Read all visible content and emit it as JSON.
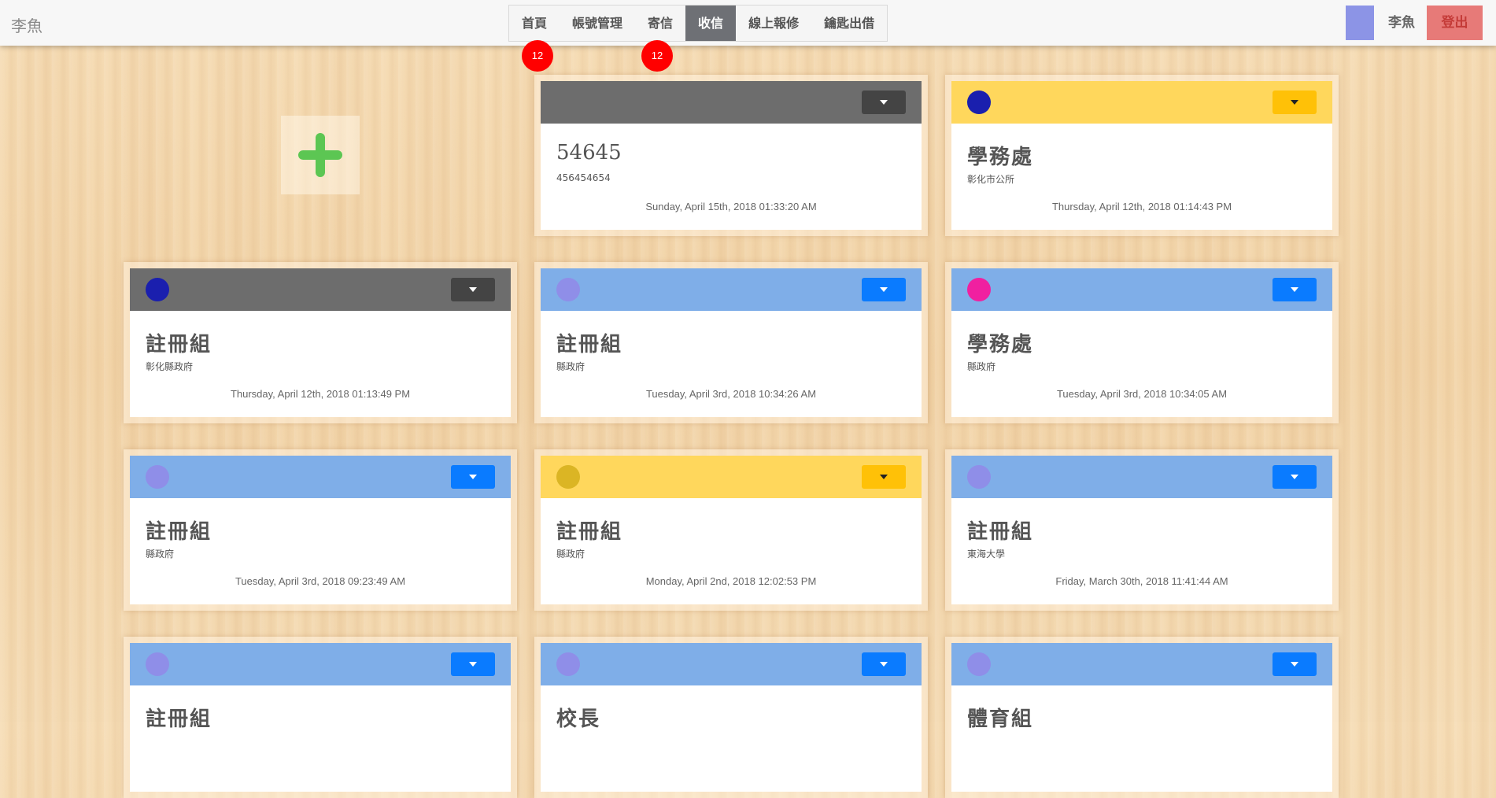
{
  "navbar": {
    "brand": "李魚",
    "items": [
      {
        "label": "首頁",
        "badge": "12",
        "active": false
      },
      {
        "label": "帳號管理",
        "badge": "",
        "active": false
      },
      {
        "label": "寄信",
        "badge": "12",
        "active": false
      },
      {
        "label": "收信",
        "badge": "",
        "active": true
      },
      {
        "label": "線上報修",
        "badge": "",
        "active": false
      },
      {
        "label": "鑰匙出借",
        "badge": "",
        "active": false
      }
    ],
    "user_name": "李魚",
    "logout_label": "登出",
    "user_color": "#8c94e6"
  },
  "add_button": {
    "icon": "plus-icon",
    "color": "#5cc653"
  },
  "cards": [
    {
      "theme": "gray",
      "dot_color": "",
      "title": "54645",
      "subtitle": "456454654",
      "date": "Sunday, April 15th, 2018 01:33:20 AM"
    },
    {
      "theme": "yellow",
      "dot_color": "#1a1fae",
      "title": "學務處",
      "subtitle": "彰化市公所",
      "date": "Thursday, April 12th, 2018 01:14:43 PM"
    },
    {
      "theme": "gray",
      "dot_color": "#1a1fae",
      "title": "註冊組",
      "subtitle": "彰化縣政府",
      "date": "Thursday, April 12th, 2018 01:13:49 PM"
    },
    {
      "theme": "blue",
      "dot_color": "#8f8ee8",
      "title": "註冊組",
      "subtitle": "縣政府",
      "date": "Tuesday, April 3rd, 2018 10:34:26 AM"
    },
    {
      "theme": "blue",
      "dot_color": "#f020a0",
      "title": "學務處",
      "subtitle": "縣政府",
      "date": "Tuesday, April 3rd, 2018 10:34:05 AM"
    },
    {
      "theme": "blue",
      "dot_color": "#8f8ee8",
      "title": "註冊組",
      "subtitle": "縣政府",
      "date": "Tuesday, April 3rd, 2018 09:23:49 AM"
    },
    {
      "theme": "yellow",
      "dot_color": "#dbb524",
      "title": "註冊組",
      "subtitle": "縣政府",
      "date": "Monday, April 2nd, 2018 12:02:53 PM"
    },
    {
      "theme": "blue",
      "dot_color": "#8f8ee8",
      "title": "註冊組",
      "subtitle": "東海大學",
      "date": "Friday, March 30th, 2018 11:41:44 AM"
    },
    {
      "theme": "blue",
      "dot_color": "#8f8ee8",
      "title": "註冊組",
      "subtitle": "",
      "date": ""
    },
    {
      "theme": "blue",
      "dot_color": "#8f8ee8",
      "title": "校長",
      "subtitle": "",
      "date": ""
    },
    {
      "theme": "blue",
      "dot_color": "#8f8ee8",
      "title": "體育組",
      "subtitle": "",
      "date": ""
    }
  ],
  "colors": {
    "gray_header": "#6d6d6d",
    "yellow_header": "#ffd75c",
    "blue_header": "#7faee8",
    "badge": "#ff0000",
    "logout_bg": "#e77a78"
  }
}
